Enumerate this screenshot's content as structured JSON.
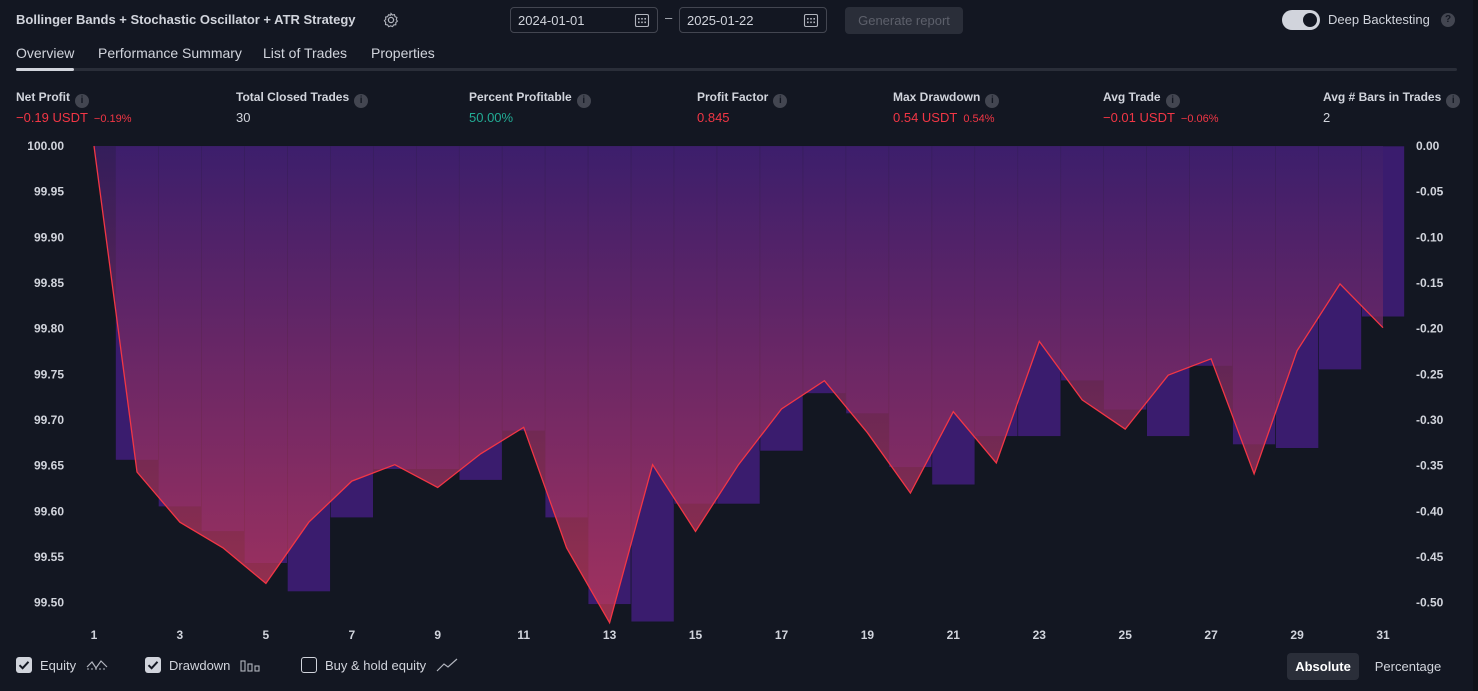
{
  "header": {
    "strategy_title": "Bollinger Bands + Stochastic Oscillator + ATR Strategy",
    "start_date": "2024-01-01",
    "end_date": "2025-01-22",
    "date_separator": "–",
    "generate_label": "Generate report",
    "deep_backtesting_label": "Deep Backtesting",
    "deep_backtesting_on": true
  },
  "tabs": [
    {
      "label": "Overview",
      "active": true
    },
    {
      "label": "Performance Summary",
      "active": false
    },
    {
      "label": "List of Trades",
      "active": false
    },
    {
      "label": "Properties",
      "active": false
    }
  ],
  "metrics": {
    "net_profit": {
      "label": "Net Profit",
      "value": "−0.19 USDT",
      "sub": "−0.19%"
    },
    "total_closed_trades": {
      "label": "Total Closed Trades",
      "value": "30"
    },
    "percent_profitable": {
      "label": "Percent Profitable",
      "value": "50.00%"
    },
    "profit_factor": {
      "label": "Profit Factor",
      "value": "0.845"
    },
    "max_drawdown": {
      "label": "Max Drawdown",
      "value": "0.54 USDT",
      "sub": "0.54%"
    },
    "avg_trade": {
      "label": "Avg Trade",
      "value": "−0.01 USDT",
      "sub": "−0.06%"
    },
    "avg_bars": {
      "label": "Avg # Bars in Trades",
      "value": "2"
    }
  },
  "colors": {
    "negative": "#f23645",
    "positive": "#22ab94",
    "drawdown_bar": "#3a1c6e",
    "equity_line": "#f23645",
    "background": "#131722"
  },
  "chart_data": {
    "type": "line",
    "x": [
      1,
      2,
      3,
      4,
      5,
      6,
      7,
      8,
      9,
      10,
      11,
      12,
      13,
      14,
      15,
      16,
      17,
      18,
      19,
      20,
      21,
      22,
      23,
      24,
      25,
      26,
      27,
      28,
      29,
      30,
      31
    ],
    "x_tick_labels": [
      "1",
      "3",
      "5",
      "7",
      "9",
      "11",
      "13",
      "15",
      "17",
      "19",
      "21",
      "23",
      "25",
      "27",
      "29",
      "31"
    ],
    "left_axis": {
      "ylim": [
        99.47,
        100.0
      ],
      "ticks": [
        "100.00",
        "99.95",
        "99.90",
        "99.85",
        "99.80",
        "99.75",
        "99.70",
        "99.65",
        "99.60",
        "99.55",
        "99.50"
      ]
    },
    "right_axis": {
      "ylim": [
        -0.53,
        0.0
      ],
      "ticks": [
        "0.00",
        "-0.05",
        "-0.10",
        "-0.15",
        "-0.20",
        "-0.25",
        "-0.30",
        "-0.35",
        "-0.40",
        "-0.45",
        "-0.50"
      ]
    },
    "series": [
      {
        "name": "Equity",
        "values": [
          100.0,
          99.643,
          99.588,
          99.56,
          99.521,
          99.588,
          99.633,
          99.651,
          99.626,
          99.663,
          99.692,
          99.56,
          99.478,
          99.651,
          99.578,
          99.651,
          99.712,
          99.743,
          99.686,
          99.62,
          99.709,
          99.653,
          99.786,
          99.722,
          99.69,
          99.749,
          99.767,
          99.641,
          99.776,
          99.849,
          99.801
        ]
      },
      {
        "name": "Drawdown",
        "values": [
          0.0,
          -0.344,
          -0.395,
          -0.422,
          -0.457,
          -0.488,
          -0.407,
          -0.354,
          -0.354,
          -0.366,
          -0.312,
          -0.407,
          -0.502,
          -0.521,
          -0.392,
          -0.392,
          -0.334,
          -0.271,
          -0.293,
          -0.352,
          -0.371,
          -0.318,
          -0.318,
          -0.257,
          -0.289,
          -0.318,
          -0.241,
          -0.327,
          -0.331,
          -0.245,
          -0.187
        ]
      }
    ],
    "legend": {
      "equity_label": "Equity",
      "drawdown_label": "Drawdown",
      "buyhold_label": "Buy & hold equity",
      "equity_on": true,
      "drawdown_on": true,
      "buyhold_on": false
    },
    "mode": {
      "absolute_label": "Absolute",
      "percentage_label": "Percentage",
      "selected": "Absolute"
    }
  }
}
